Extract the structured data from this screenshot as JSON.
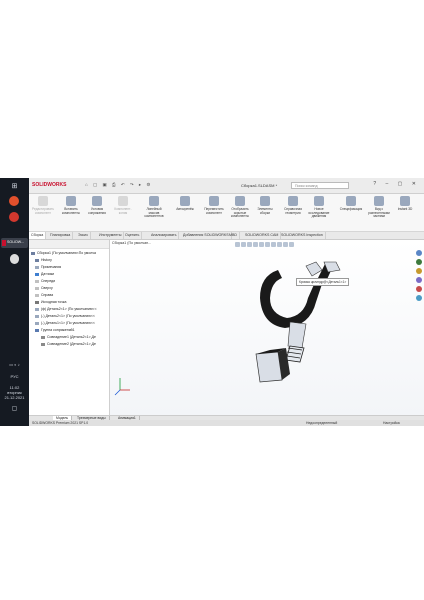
{
  "taskbar": {
    "app_label": "SOLIDW...",
    "lang": "РУС",
    "time": "11:02",
    "weekday": "вторник",
    "date": "21.12.2021"
  },
  "titlebar": {
    "logo": "SOLIDWORKS",
    "doc_title": "Сборка1.SLDASM *",
    "search_placeholder": "Поиск команд"
  },
  "ribbon": [
    {
      "label": "Редактировать компонент",
      "enabled": false
    },
    {
      "label": "Вставить компоненты",
      "enabled": true
    },
    {
      "label": "Условия сопряжения",
      "enabled": true
    },
    {
      "label": "Компонент-копия",
      "enabled": false
    },
    {
      "label": "Линейный массив компонентов",
      "enabled": true
    },
    {
      "label": "Автокрепёж",
      "enabled": true
    },
    {
      "label": "Переместить компонент",
      "enabled": true
    },
    {
      "label": "Отобразить скрытые компоненты",
      "enabled": true
    },
    {
      "label": "Элементы сборки",
      "enabled": true
    },
    {
      "label": "Справочная геометрия",
      "enabled": true
    },
    {
      "label": "Новое исследование движения",
      "enabled": true
    },
    {
      "label": "Спецификация",
      "enabled": true
    },
    {
      "label": "Вид с разнесенными частями",
      "enabled": true
    },
    {
      "label": "Instant 3D",
      "enabled": true
    }
  ],
  "tabs": [
    {
      "label": "Сборка",
      "active": true
    },
    {
      "label": "Планировка",
      "active": false
    },
    {
      "label": "Эскиз",
      "active": false
    },
    {
      "label": "Инструменты",
      "active": false
    },
    {
      "label": "Оценить",
      "active": false
    },
    {
      "label": "Анализировать",
      "active": false
    },
    {
      "label": "Добавления SOLIDWORKS",
      "active": false
    },
    {
      "label": "MBD",
      "active": false
    },
    {
      "label": "SOLIDWORKS CAM",
      "active": false
    },
    {
      "label": "SOLIDWORKS Inspection",
      "active": false
    }
  ],
  "tree": [
    "Сборка1 (По умолчанию<По умолча",
    "History",
    "Примечания",
    "Датчики",
    "Спереди",
    "Сверху",
    "Справа",
    "Исходная точка",
    "(ф) Деталь2<1> (По умолчанию<<",
    "(-) Деталь2<1> (По умолчанию<<",
    "(-) Деталь1<1> (По умолчанию<<",
    "Группа сопряжений1",
    "Совпадение1 (Деталь2<1>,Де",
    "Совпадение2 (Деталь2<1>,Де"
  ],
  "viewport": {
    "title": "Сборка1 (По умолчан...",
    "tooltip": "Кромка цилиндр@<Деталь1<1>"
  },
  "bottom_tabs": [
    "Модель",
    "Трехмерные виды",
    "Анимация1"
  ],
  "status": {
    "left": "SOLIDWORKS Premium 2021 SP1.0",
    "center": "Недоопределенный",
    "right": "Настройка"
  },
  "colors": {
    "brand": "#c8102e",
    "taskbar": "#151a22",
    "part_dark": "#1a1a1a",
    "part_light": "#d9dee6"
  }
}
